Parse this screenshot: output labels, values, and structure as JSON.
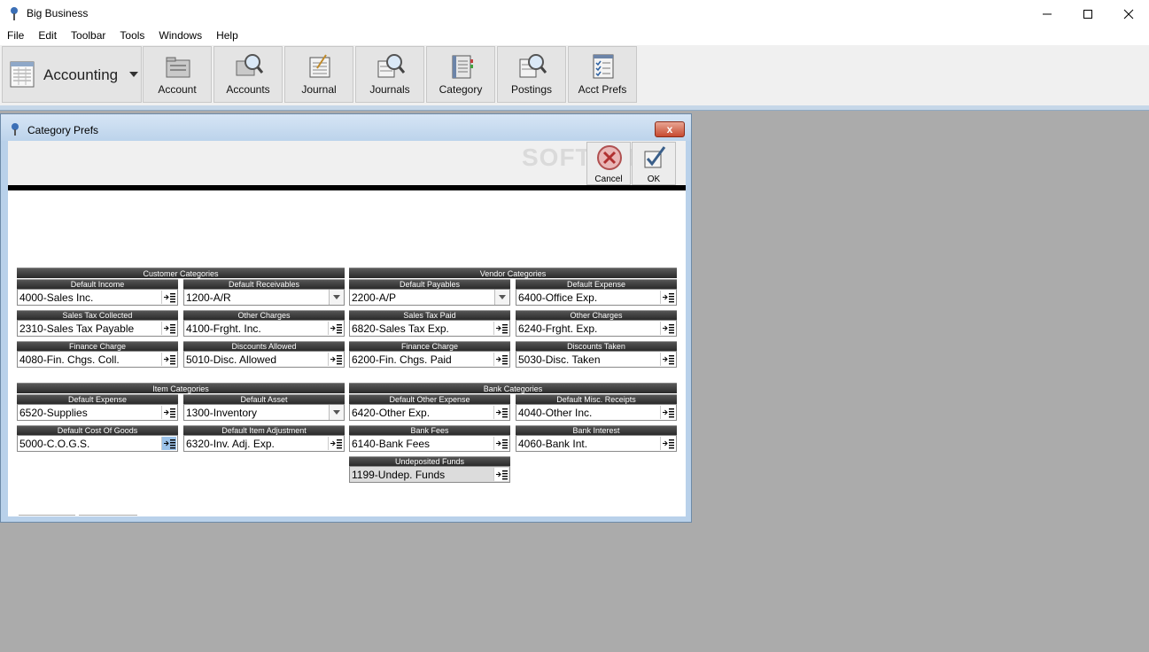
{
  "window": {
    "title": "Big Business"
  },
  "menu": [
    "File",
    "Edit",
    "Toolbar",
    "Tools",
    "Windows",
    "Help"
  ],
  "toolbar": {
    "module_label": "Accounting",
    "buttons": [
      "Account",
      "Accounts",
      "Journal",
      "Journals",
      "Category",
      "Postings",
      "Acct Prefs"
    ]
  },
  "dialog": {
    "title": "Category Prefs",
    "close_label": "x",
    "cancel_label": "Cancel",
    "ok_label": "OK",
    "watermark": "SOFTPEDIA"
  },
  "customer": {
    "title": "Customer Categories",
    "default_income": {
      "label": "Default Income",
      "value": "4000-Sales Inc."
    },
    "default_receivables": {
      "label": "Default Receivables",
      "value": "1200-A/R"
    },
    "sales_tax_collected": {
      "label": "Sales Tax Collected",
      "value": "2310-Sales Tax Payable"
    },
    "other_charges": {
      "label": "Other Charges",
      "value": "4100-Frght. Inc."
    },
    "finance_charge": {
      "label": "Finance Charge",
      "value": "4080-Fin. Chgs. Coll."
    },
    "discounts_allowed": {
      "label": "Discounts Allowed",
      "value": "5010-Disc. Allowed"
    }
  },
  "vendor": {
    "title": "Vendor Categories",
    "default_payables": {
      "label": "Default Payables",
      "value": "2200-A/P"
    },
    "default_expense": {
      "label": "Default Expense",
      "value": "6400-Office Exp."
    },
    "sales_tax_paid": {
      "label": "Sales Tax Paid",
      "value": "6820-Sales Tax Exp."
    },
    "other_charges": {
      "label": "Other Charges",
      "value": "6240-Frght. Exp."
    },
    "finance_charge": {
      "label": "Finance Charge",
      "value": "6200-Fin. Chgs. Paid"
    },
    "discounts_taken": {
      "label": "Discounts Taken",
      "value": "5030-Disc. Taken"
    }
  },
  "item": {
    "title": "Item Categories",
    "default_expense": {
      "label": "Default Expense",
      "value": "6520-Supplies"
    },
    "default_asset": {
      "label": "Default Asset",
      "value": "1300-Inventory"
    },
    "default_cogs": {
      "label": "Default Cost Of Goods",
      "value": "5000-C.O.G.S."
    },
    "default_item_adjustment": {
      "label": "Default Item Adjustment",
      "value": "6320-Inv. Adj. Exp."
    }
  },
  "bank": {
    "title": "Bank Categories",
    "default_other_expense": {
      "label": "Default Other Expense",
      "value": "6420-Other Exp."
    },
    "default_misc_receipts": {
      "label": "Default Misc. Receipts",
      "value": "4040-Other Inc."
    },
    "bank_fees": {
      "label": "Bank Fees",
      "value": "6140-Bank Fees"
    },
    "bank_interest": {
      "label": "Bank Interest",
      "value": "4060-Bank Int."
    },
    "undeposited_funds": {
      "label": "Undeposited Funds",
      "value": "1199-Undep. Funds"
    }
  }
}
